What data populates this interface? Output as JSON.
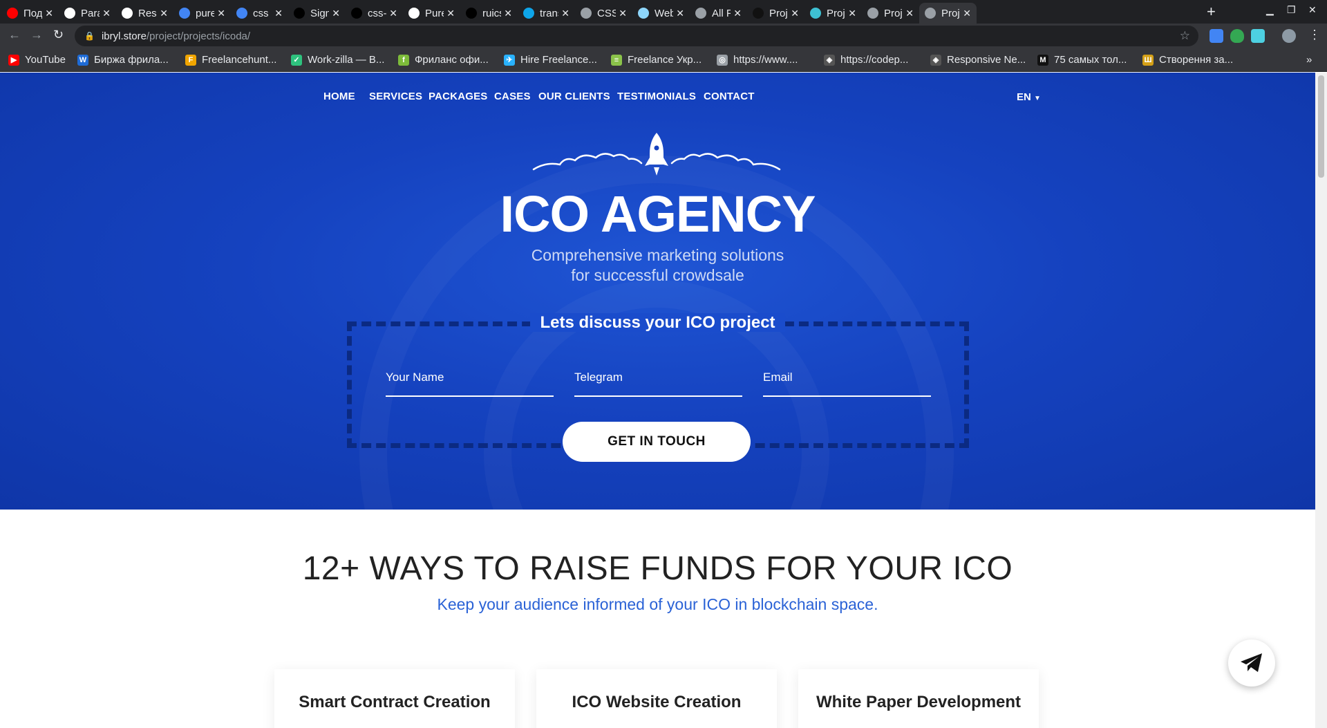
{
  "browser": {
    "tabs": [
      {
        "title": "Подп",
        "icon": "youtube-icon",
        "color": "#ff0000"
      },
      {
        "title": "Paral",
        "icon": "codepen-icon",
        "color": "#ffffff"
      },
      {
        "title": "Respc",
        "icon": "codepen-icon",
        "color": "#ffffff"
      },
      {
        "title": "pure",
        "icon": "google-icon",
        "color": "#4285f4"
      },
      {
        "title": "css or",
        "icon": "google-icon",
        "color": "#4285f4"
      },
      {
        "title": "Signi",
        "icon": "github-icon",
        "color": "#000000"
      },
      {
        "title": "css-or",
        "icon": "github-icon",
        "color": "#000000"
      },
      {
        "title": "Pure",
        "icon": "codepen-icon",
        "color": "#ffffff"
      },
      {
        "title": "ruics",
        "icon": "github-icon",
        "color": "#000000"
      },
      {
        "title": "trans",
        "icon": "translate-icon",
        "color": "#0ea5e9"
      },
      {
        "title": "CSS C",
        "icon": "globe-icon",
        "color": "#9aa0a6"
      },
      {
        "title": "Webp",
        "icon": "webpack-icon",
        "color": "#8ed6fb"
      },
      {
        "title": "All Pr",
        "icon": "globe-icon",
        "color": "#9aa0a6"
      },
      {
        "title": "Proje",
        "icon": "arrow-icon",
        "color": "#111111"
      },
      {
        "title": "Proje",
        "icon": "image-icon",
        "color": "#3ec1d3"
      },
      {
        "title": "Proje",
        "icon": "globe-icon",
        "color": "#9aa0a6"
      },
      {
        "title": "Proje",
        "icon": "globe-icon",
        "color": "#9aa0a6"
      }
    ],
    "url_host": "ibryl.store",
    "url_path": "/project/projects/icoda/",
    "bookmarks": [
      {
        "label": "YouTube",
        "icon": "youtube-icon",
        "color": "#ff0000",
        "glyph": "▶"
      },
      {
        "label": "Биржа фрила...",
        "icon": "weblancer-icon",
        "color": "#1e6bd6",
        "glyph": "W"
      },
      {
        "label": "Freelancehunt...",
        "icon": "freelancehunt-icon",
        "color": "#f0a500",
        "glyph": "F"
      },
      {
        "label": "Work-zilla — В...",
        "icon": "workzilla-icon",
        "color": "#2ec27e",
        "glyph": "✓"
      },
      {
        "label": "Фриланс офи...",
        "icon": "fl-icon",
        "color": "#7dbb3a",
        "glyph": "f"
      },
      {
        "label": "Hire Freelance...",
        "icon": "freelancer-icon",
        "color": "#29b2fe",
        "glyph": "✈"
      },
      {
        "label": "Freelance Укр...",
        "icon": "freelance-ua-icon",
        "color": "#8bc34a",
        "glyph": "≡"
      },
      {
        "label": "https://www....",
        "icon": "globe-icon",
        "color": "#9aa0a6",
        "glyph": "◎"
      },
      {
        "label": "https://codep...",
        "icon": "codepen-icon",
        "color": "#555555",
        "glyph": "◈"
      },
      {
        "label": "Responsive Ne...",
        "icon": "codepen-icon",
        "color": "#555555",
        "glyph": "◈"
      },
      {
        "label": "75 самых тол...",
        "icon": "medium-icon",
        "color": "#111111",
        "glyph": "M"
      },
      {
        "label": "Створення за...",
        "icon": "ua-icon",
        "color": "#d4a017",
        "glyph": "Ш"
      }
    ]
  },
  "nav": {
    "items": [
      "HOME",
      "SERVICES",
      "PACKAGES",
      "CASES",
      "OUR CLIENTS",
      "TESTIMONIALS",
      "CONTACT"
    ],
    "lang": "EN"
  },
  "hero": {
    "title": "ICO AGENCY",
    "subtitle_line1": "Comprehensive marketing solutions",
    "subtitle_line2": "for successful crowdsale"
  },
  "form": {
    "title": "Lets discuss your ICO project",
    "name_placeholder": "Your Name",
    "telegram_placeholder": "Telegram",
    "email_placeholder": "Email",
    "submit_label": "GET IN TOUCH"
  },
  "services": {
    "title": "12+ WAYS TO RAISE FUNDS FOR YOUR ICO",
    "subtitle": "Keep your audience informed of your ICO in blockchain space.",
    "cards": [
      "Smart Contract Creation",
      "ICO Website Creation",
      "White Paper Development"
    ]
  },
  "colors": {
    "hero_blue": "#1542bf",
    "accent_blue": "#2a62d6"
  }
}
